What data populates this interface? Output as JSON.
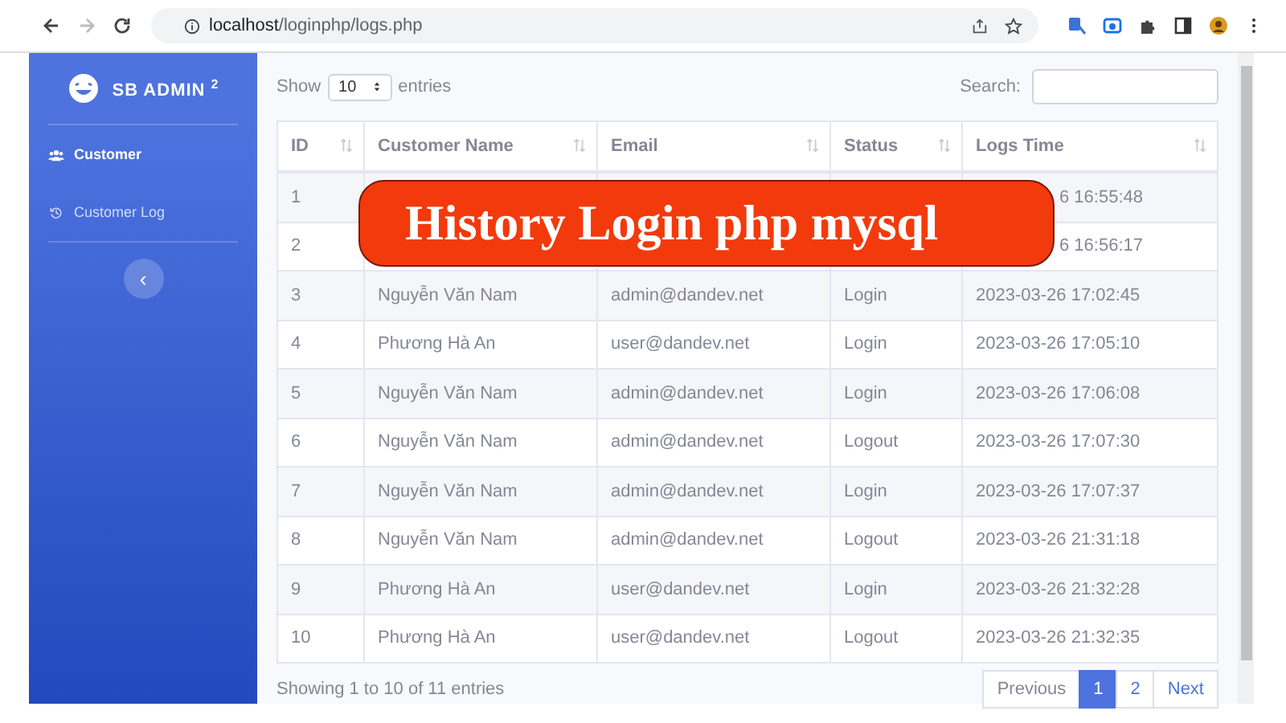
{
  "browser": {
    "url_host": "localhost",
    "url_path": "/loginphp/logs.php"
  },
  "sidebar": {
    "brand": "SB ADMIN",
    "brand_sup": "2",
    "items": [
      {
        "label": "Customer",
        "selected": true,
        "kind": "users"
      },
      {
        "label": "Customer Log",
        "selected": false,
        "kind": "history"
      }
    ],
    "toggle": "‹"
  },
  "controls": {
    "show_label": "Show",
    "length": "10",
    "entries_label": "entries",
    "search_label": "Search:"
  },
  "table": {
    "columns": [
      "ID",
      "Customer Name",
      "Email",
      "Status",
      "Logs Time"
    ],
    "rows": [
      [
        "1",
        "",
        "",
        "",
        "6 16:55:48"
      ],
      [
        "2",
        "",
        "",
        "",
        "6 16:56:17"
      ],
      [
        "3",
        "Nguyễn Văn Nam",
        "admin@dandev.net",
        "Login",
        "2023-03-26 17:02:45"
      ],
      [
        "4",
        "Phương Hà An",
        "user@dandev.net",
        "Login",
        "2023-03-26 17:05:10"
      ],
      [
        "5",
        "Nguyễn Văn Nam",
        "admin@dandev.net",
        "Login",
        "2023-03-26 17:06:08"
      ],
      [
        "6",
        "Nguyễn Văn Nam",
        "admin@dandev.net",
        "Logout",
        "2023-03-26 17:07:30"
      ],
      [
        "7",
        "Nguyễn Văn Nam",
        "admin@dandev.net",
        "Login",
        "2023-03-26 17:07:37"
      ],
      [
        "8",
        "Nguyễn Văn Nam",
        "admin@dandev.net",
        "Logout",
        "2023-03-26 21:31:18"
      ],
      [
        "9",
        "Phương Hà An",
        "user@dandev.net",
        "Login",
        "2023-03-26 21:32:28"
      ],
      [
        "10",
        "Phương Hà An",
        "user@dandev.net",
        "Logout",
        "2023-03-26 21:32:35"
      ]
    ]
  },
  "info": "Showing 1 to 10 of 11 entries",
  "pagination": [
    {
      "label": "Previous",
      "selected": false
    },
    {
      "label": "1",
      "selected": true
    },
    {
      "label": "2",
      "selected": false
    },
    {
      "label": "Next",
      "selected": false
    }
  ],
  "banner": "History Login php mysql"
}
